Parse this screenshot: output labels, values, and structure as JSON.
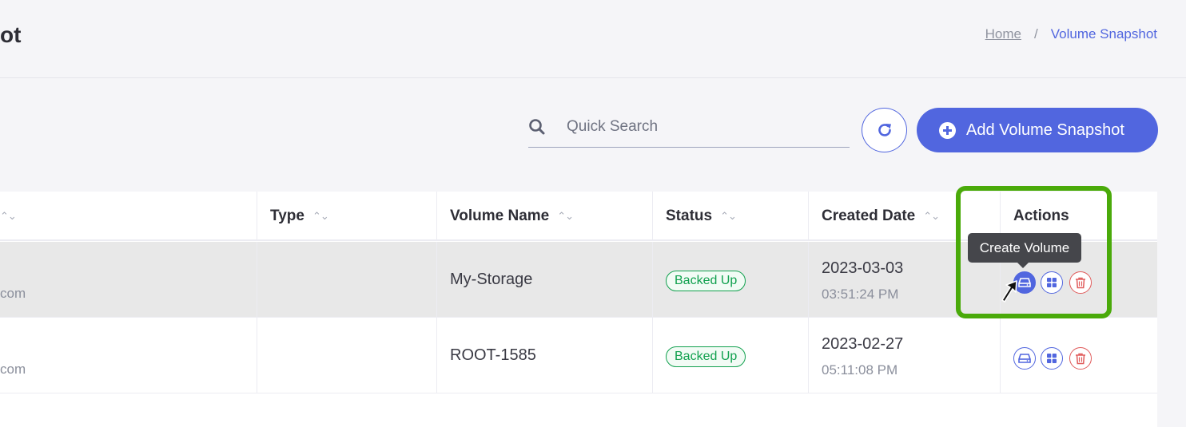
{
  "header": {
    "title": "ot",
    "breadcrumb": {
      "home": "Home",
      "separator": "/",
      "current": "Volume Snapshot"
    }
  },
  "toolbar": {
    "search_placeholder": "Quick Search",
    "refresh_icon": "refresh-icon",
    "add_label": "Add Volume Snapshot",
    "add_icon": "plus-circle-icon"
  },
  "table": {
    "columns": [
      "Type",
      "Volume Name",
      "Status",
      "Created Date",
      "Actions"
    ],
    "rows": [
      {
        "email_fragment": "com",
        "type": "",
        "volume_name": "My-Storage",
        "status": "Backed Up",
        "date": "2023-03-03",
        "time": "03:51:24 PM"
      },
      {
        "email_fragment": "com",
        "type": "",
        "volume_name": "ROOT-1585",
        "status": "Backed Up",
        "date": "2023-02-27",
        "time": "05:11:08 PM"
      }
    ]
  },
  "tooltip": "Create Volume",
  "colors": {
    "accent": "#5166df",
    "success": "#12a14f",
    "danger": "#e05b5b",
    "highlight": "#4aaa0a"
  }
}
